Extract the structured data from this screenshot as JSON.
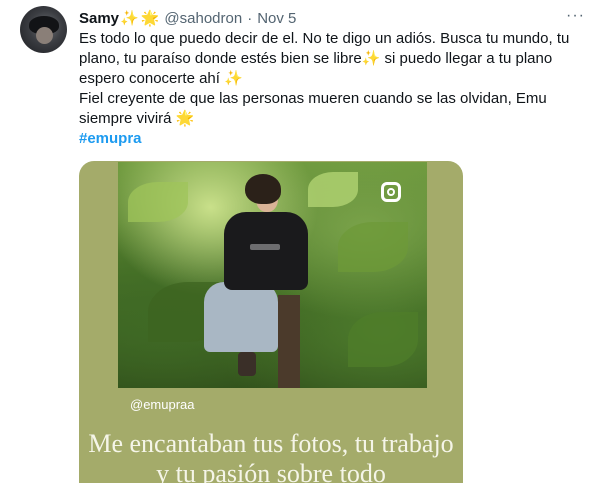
{
  "tweet": {
    "author": {
      "display_name": "Samy",
      "name_emojis": [
        "sparkles",
        "glowing-star"
      ],
      "handle": "@sahodron",
      "separator": "·",
      "date": "Nov 5"
    },
    "more_menu": "···",
    "text": {
      "line1": "Es todo lo que puedo decir de el. No te digo un adiós. Busca tu mundo, tu plano, tu paraíso donde estés bien se libre",
      "line1_emoji": "✨",
      "line1_cont": " si puedo llegar a tu plano espero conocerte ahí ",
      "line1_end_emoji": "✨",
      "line2": "Fiel creyente de que las personas mueren cuando se las olvidan, Emu siempre vivirá ",
      "line2_emoji": "🌟",
      "hashtag": "#emupra"
    },
    "media": {
      "username_overlay": "@emupraa",
      "quote_text": "Me encantaban tus fotos, tu trabajo y tu pasión sobre todo",
      "background_color": "#a4ab6a"
    }
  },
  "colors": {
    "text": "#0f1419",
    "secondary": "#536471",
    "link": "#1d9bf0"
  }
}
